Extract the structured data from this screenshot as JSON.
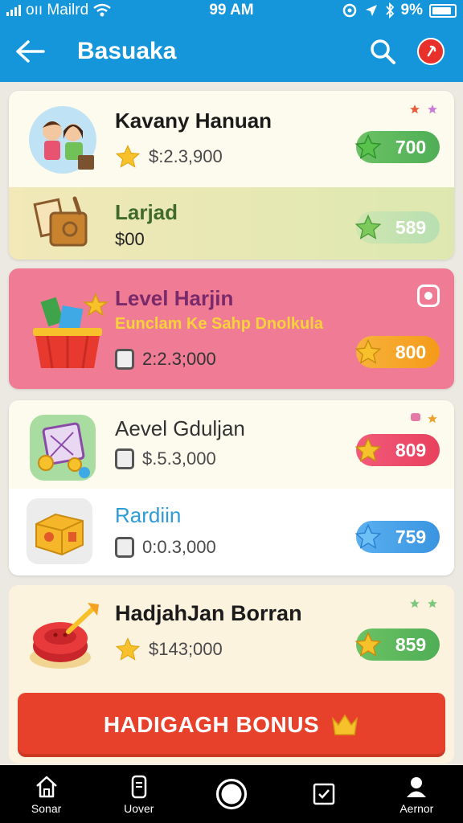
{
  "status": {
    "carrier": "oıı Mailrd",
    "time": "99 AM",
    "battery": "9%"
  },
  "appbar": {
    "title": "Basuaka"
  },
  "cards": [
    {
      "name": "Kavany Hanuan",
      "price": "$:2.3,900",
      "badge": "700",
      "sub": {
        "name": "Larjad",
        "price": "$00",
        "badge": "589"
      }
    },
    {
      "name": "Level Harjin",
      "subtitle": "Euncla‌m Ke Sah‌p Dnolkula",
      "price": "2:2.3;000",
      "badge": "800"
    },
    {
      "name": "Aevel Gdulj‌an",
      "price": "$.5.3,000",
      "badge": "809",
      "sub": {
        "name": "Rardiin",
        "price": "0:0.3,000",
        "badge": "759"
      }
    },
    {
      "name": "HadjahJan Borran",
      "price": "$143;000",
      "badge": "859"
    }
  ],
  "bonus_button": {
    "label": "HADIGAGH BONUS"
  },
  "nav": [
    {
      "label": "Sonar",
      "icon": "home-icon"
    },
    {
      "label": "Uover",
      "icon": "document-icon"
    },
    {
      "label": "",
      "icon": "record-button-icon"
    },
    {
      "label": "",
      "icon": "checklist-icon"
    },
    {
      "label": "Aernor",
      "icon": "profile-icon"
    }
  ],
  "colors": {
    "appbar": "#1596da",
    "green_badge": "#5cb85c",
    "orange_badge": "#f5a623",
    "pink_badge": "#ee4b6a",
    "blue_badge": "#3aa0e8",
    "pink_card": "#f07b95",
    "bonus": "#e8412b"
  }
}
